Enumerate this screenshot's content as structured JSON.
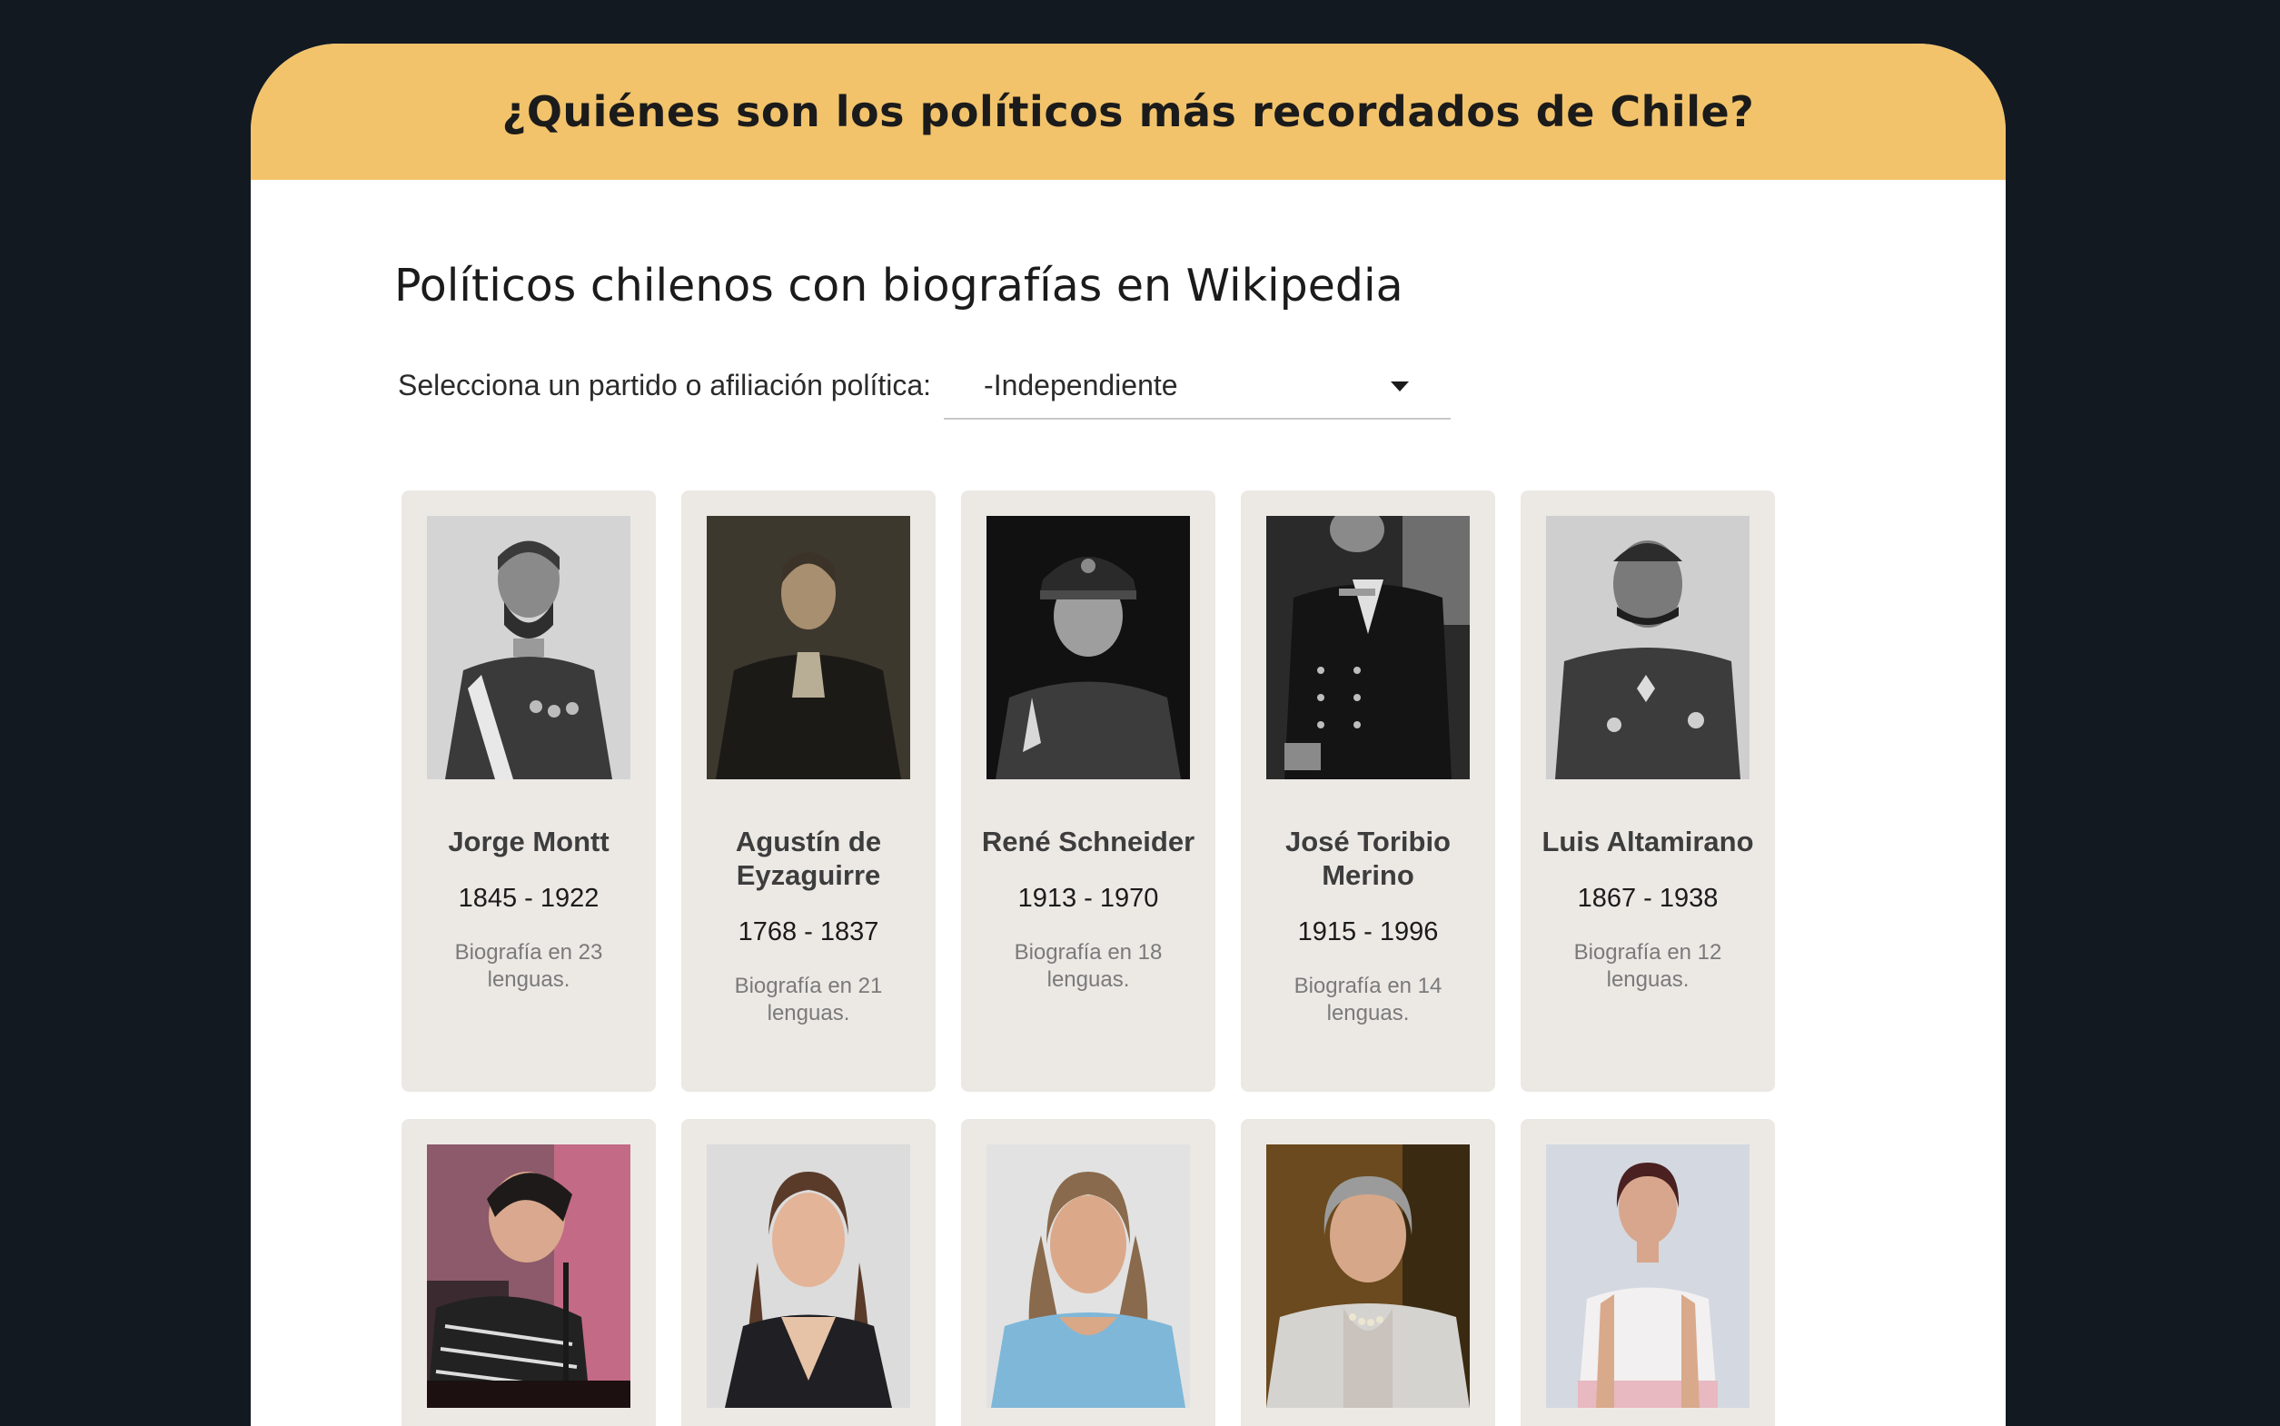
{
  "header": {
    "title": "¿Quiénes son los políticos más recordados de Chile?"
  },
  "section": {
    "title": "Políticos chilenos con biografías en Wikipedia"
  },
  "filter": {
    "label": "Selecciona un partido o afiliación política:",
    "selected": "-Independiente"
  },
  "politicians": [
    {
      "name": "Jorge Montt",
      "years": "1845 - 1922",
      "langs": "Biografía en 23 lenguas."
    },
    {
      "name": "Agustín de Eyzaguirre",
      "years": "1768 - 1837",
      "langs": "Biografía en 21 lenguas."
    },
    {
      "name": "René Schneider",
      "years": "1913 - 1970",
      "langs": "Biografía en 18 lenguas."
    },
    {
      "name": "José Toribio Merino",
      "years": "1915 - 1996",
      "langs": "Biografía en 14 lenguas."
    },
    {
      "name": "Luis Altamirano",
      "years": "1867 - 1938",
      "langs": "Biografía en 12 lenguas."
    }
  ],
  "colors": {
    "background": "#121921",
    "banner": "#f2c36b",
    "card": "#ece9e5"
  }
}
